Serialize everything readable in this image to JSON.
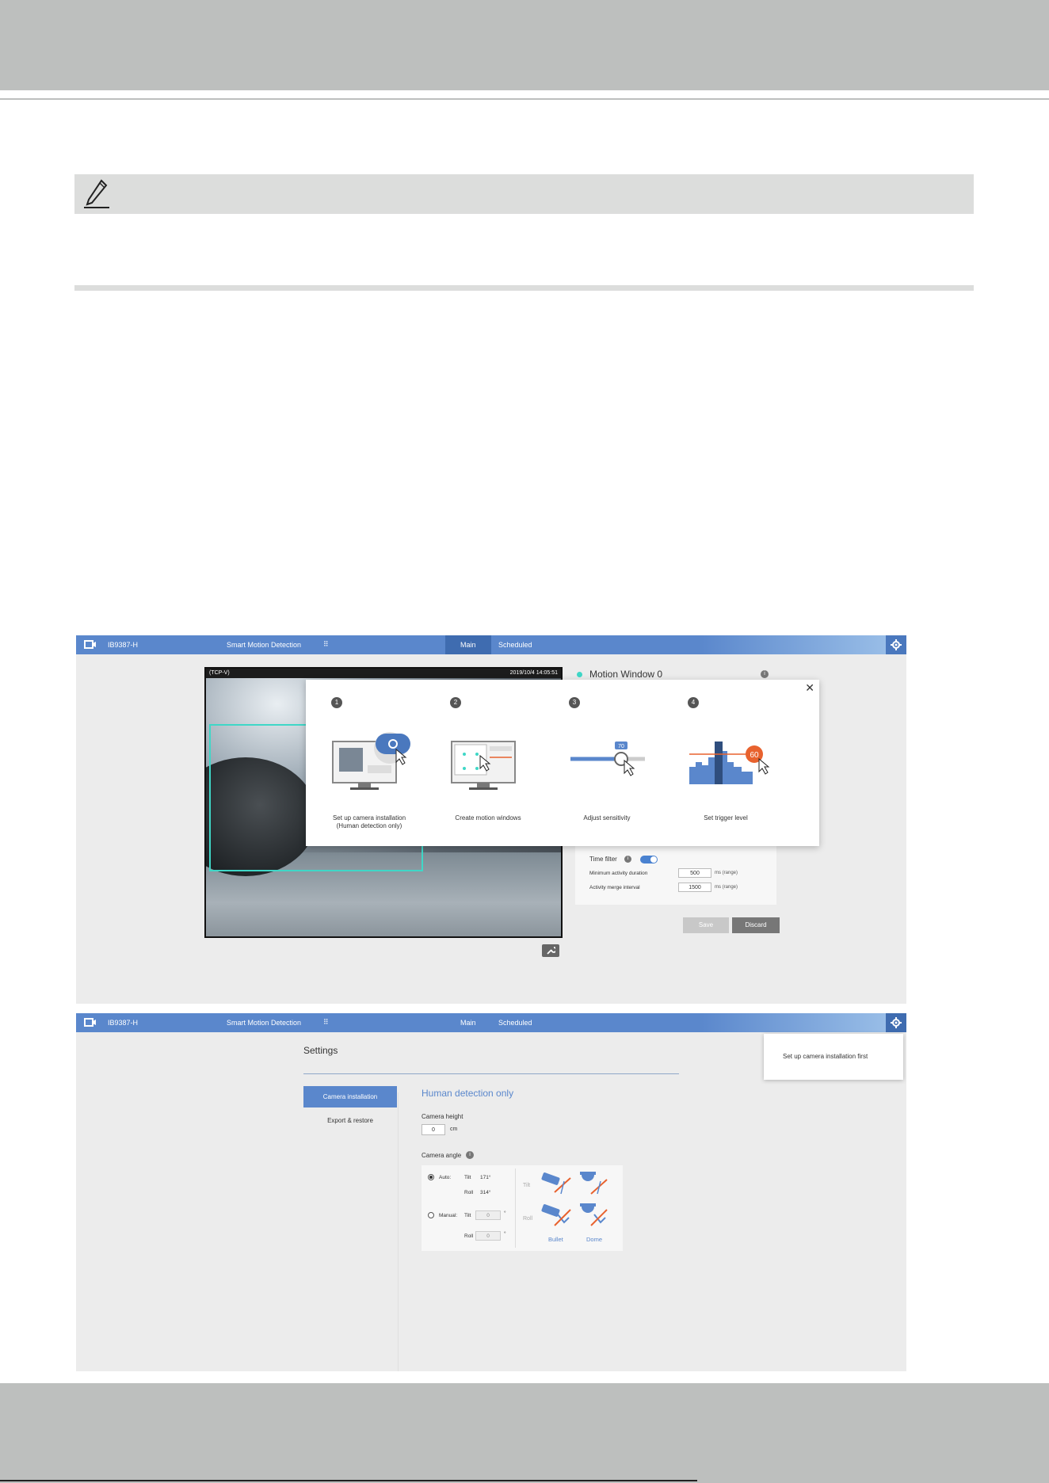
{
  "app": {
    "model": "IB9387-H",
    "app_name": "Smart Motion Detection",
    "tabs": [
      "Main",
      "Scheduled"
    ]
  },
  "main_view": {
    "video": {
      "osd_left": "(TCP-V)",
      "osd_right": "2019/10/4 14:05:51"
    },
    "motion_window_title": "Motion Window 0",
    "wizard": {
      "steps": [
        {
          "number": "1",
          "label_line1": "Set up camera installation",
          "label_line2": "(Human detection only)"
        },
        {
          "number": "2",
          "label_line1": "Create motion windows",
          "label_line2": ""
        },
        {
          "number": "3",
          "label_line1": "Adjust sensitivity",
          "label_line2": ""
        },
        {
          "number": "4",
          "label_line1": "Set trigger level",
          "label_line2": ""
        }
      ],
      "slider_value": "70",
      "trigger_value": "60"
    },
    "time_filter": {
      "label": "Time filter",
      "min_duration_label": "Minimum activity duration",
      "min_duration_value": "500",
      "merge_interval_label": "Activity merge interval",
      "merge_interval_value": "1500",
      "unit": "ms (range)"
    },
    "buttons": {
      "save": "Save",
      "discard": "Discard"
    }
  },
  "settings_view": {
    "popover_text": "Set up camera installation first",
    "title": "Settings",
    "nav": [
      "Camera installation",
      "Export & restore"
    ],
    "section_title": "Human detection only",
    "camera_height_label": "Camera height",
    "camera_height_value": "0",
    "camera_height_unit": "cm",
    "camera_angle_label": "Camera angle",
    "auto_label": "Auto:",
    "manual_label": "Manual:",
    "tilt_label": "Tilt",
    "roll_label": "Roll",
    "auto_tilt": "171°",
    "auto_roll": "314°",
    "manual_tilt": "0",
    "manual_roll": "0",
    "degree": "°",
    "bullet_label": "Bullet",
    "dome_label": "Dome"
  },
  "colors": {
    "accent": "#5a87cc",
    "roi": "#3fd7c7",
    "trigger": "#e8622e"
  }
}
